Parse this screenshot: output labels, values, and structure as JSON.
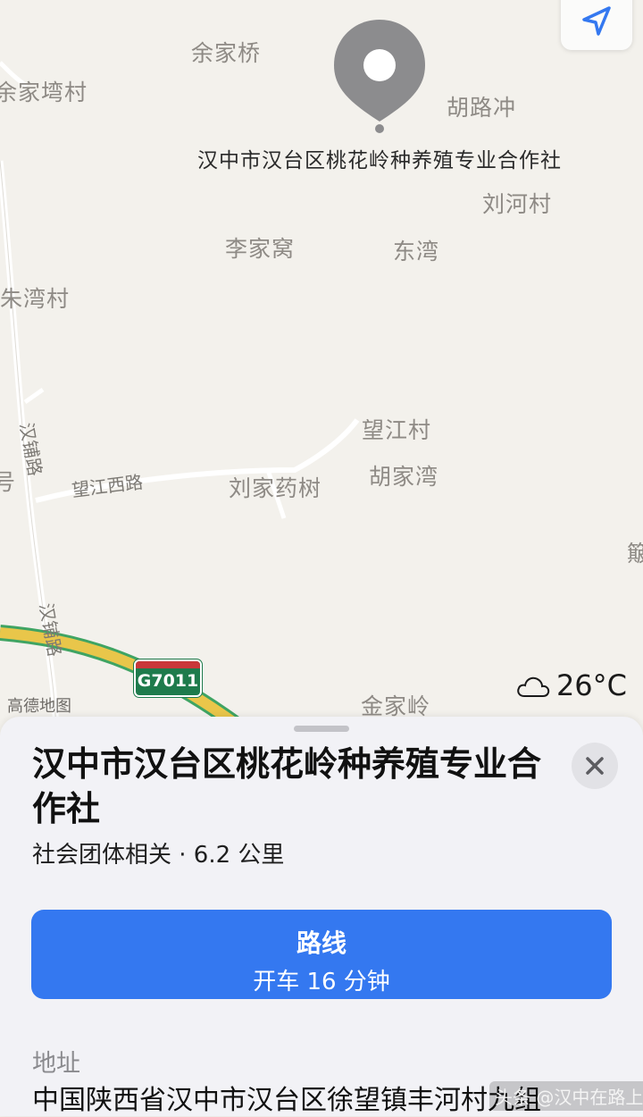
{
  "map": {
    "places": [
      {
        "id": "yujiaqiao",
        "label": "余家桥"
      },
      {
        "id": "yujiawancun",
        "label": "余家塆村"
      },
      {
        "id": "hulugchong",
        "label": "胡路冲"
      },
      {
        "id": "liuhecun",
        "label": "刘河村"
      },
      {
        "id": "lijiawo",
        "label": "李家窝"
      },
      {
        "id": "dongwan",
        "label": "东湾"
      },
      {
        "id": "zhuwancun",
        "label": "朱湾村"
      },
      {
        "id": "wangjiangcun",
        "label": "望江村"
      },
      {
        "id": "hujiawan",
        "label": "胡家湾"
      },
      {
        "id": "liujiayaoshu",
        "label": "刘家药树"
      },
      {
        "id": "jinjialing",
        "label": "金家岭"
      }
    ],
    "roads": {
      "hanpu_upper": "汉铺路",
      "hanpu_lower": "汉铺路",
      "wangjiang_west": "望江西路"
    },
    "partial_labels": {
      "left_edge": "号",
      "right_edge": "簸"
    },
    "pin_title": "汉中市汉台区桃花岭种养殖专业合作社",
    "highway_code": "G7011",
    "attribution": "高德地图",
    "weather": {
      "icon": "cloud-icon",
      "temperature": "26°C"
    },
    "locate_icon": "location-arrow-icon"
  },
  "sheet": {
    "title": "汉中市汉台区桃花岭种养殖专业合作社",
    "subtitle": "社会团体相关 · 6.2 公里",
    "close_icon": "close-icon",
    "route": {
      "label": "路线",
      "detail": "开车 16 分钟"
    },
    "address_label": "地址",
    "address_value": "中国陕西省汉中市汉台区徐望镇丰河村九组"
  },
  "watermark": "头条 @汉中在路上",
  "colors": {
    "accent": "#3478f0",
    "map_bg": "#f3f1ec",
    "highway": "#e9c64a",
    "highway_badge": "#1e7b4c",
    "pin": "#8c8c8e"
  }
}
